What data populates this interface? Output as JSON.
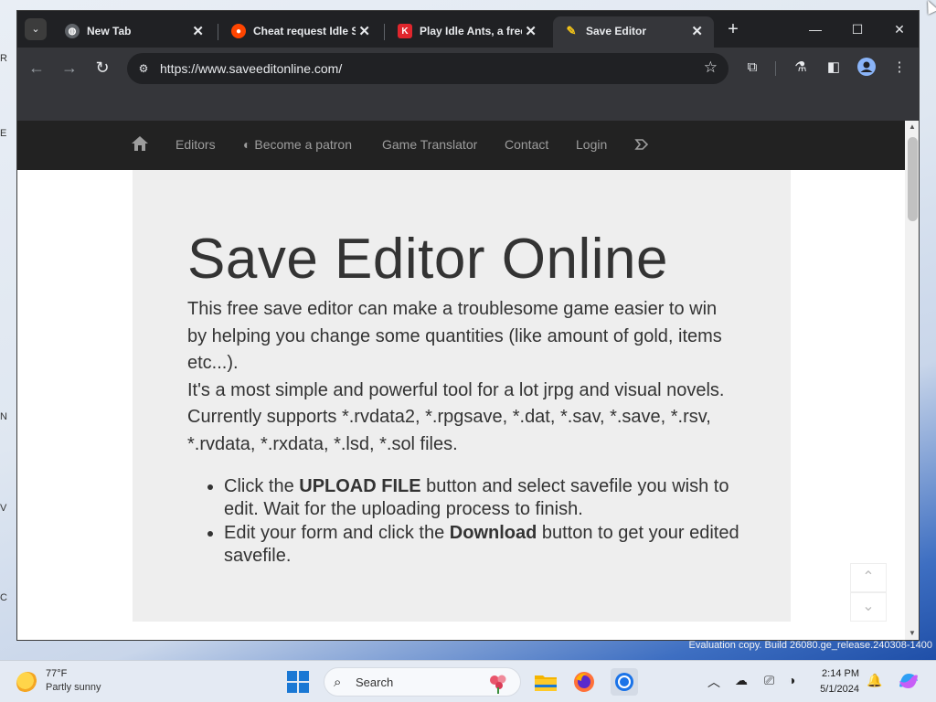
{
  "browser": {
    "tabs": [
      {
        "title": "New Tab",
        "icon": "globe-icon"
      },
      {
        "title": "Cheat request Idle S",
        "icon": "reddit-icon"
      },
      {
        "title": "Play Idle Ants, a free",
        "icon": "kongregate-icon"
      },
      {
        "title": "Save Editor",
        "icon": "save-editor-icon",
        "active": true
      }
    ],
    "url": "https://www.saveeditonline.com/"
  },
  "site": {
    "nav": [
      "Editors",
      "Become a patron",
      "Game Translator",
      "Contact",
      "Login"
    ],
    "heading": "Save Editor Online",
    "intro_1": "This free save editor can make a troublesome game easier to win by helping you change some quantities (like amount of gold, items etc...).",
    "intro_2": "It's a most simple and powerful tool for a lot jrpg and visual novels. Currently supports *.rvdata2, *.rpgsave, *.dat, *.sav, *.save, *.rsv, *.rvdata, *.rxdata, *.lsd, *.sol files.",
    "steps": [
      {
        "pre": "Click the ",
        "bold": "UPLOAD FILE",
        "post": " button and select savefile you wish to edit. Wait for the uploading process to finish."
      },
      {
        "pre": "Edit your form and click the ",
        "bold": "Download",
        "post": " button to get your edited savefile."
      }
    ]
  },
  "desktop": {
    "watermark": "Evaluation copy. Build 26080.ge_release.240308-1400"
  },
  "taskbar": {
    "temperature": "77°F",
    "condition": "Partly sunny",
    "search_label": "Search",
    "time": "2:14 PM",
    "date": "5/1/2024"
  },
  "colors": {
    "nav_bg": "#222222",
    "jumbotron_bg": "#eeeeee",
    "chrome_dark": "#202124",
    "accent": "#1a78d4"
  }
}
